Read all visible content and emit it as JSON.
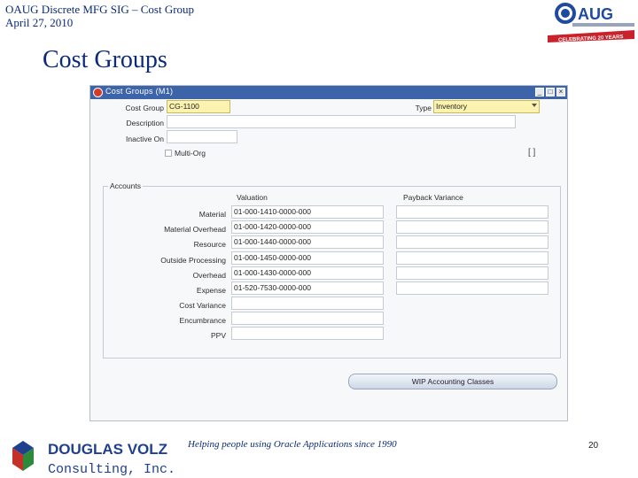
{
  "slide": {
    "header_line1": "OAUG Discrete MFG SIG – Cost Group",
    "header_line2": "April 27, 2010",
    "title": "Cost Groups",
    "footer_text": "Helping people using Oracle Applications since 1990",
    "page_number": "20",
    "oaug_logo_text": "OAUG",
    "oaug_banner": "CELEBRATING 20 YEARS",
    "company_line1": "DOUGLAS VOLZ",
    "company_line2": "Consulting, Inc.",
    "colors": {
      "title": "#0b2a7a",
      "titlebar": "#3d64a8",
      "required_field": "#fdf3b0"
    }
  },
  "window": {
    "title": "Cost Groups (M1)",
    "controls": [
      "_",
      "□",
      "×"
    ],
    "header_fields": {
      "cost_group_label": "Cost Group",
      "cost_group_value": "CG-1100",
      "type_label": "Type",
      "type_value": "Inventory",
      "description_label": "Description",
      "description_value": "",
      "inactive_on_label": "Inactive On",
      "inactive_on_value": "",
      "multi_org_label": "Multi-Org",
      "multi_org_checked": false,
      "side_hint": "[ ]"
    },
    "accounts": {
      "group_label": "Accounts",
      "valuation_header": "Valuation",
      "payback_header": "Payback Variance",
      "rows": [
        {
          "label": "Material",
          "valuation": "01-000-1410-0000-000",
          "payback": ""
        },
        {
          "label": "Material Overhead",
          "valuation": "01-000-1420-0000-000",
          "payback": ""
        },
        {
          "label": "Resource",
          "valuation": "01-000-1440-0000-000",
          "payback": ""
        },
        {
          "label": "Outside Processing",
          "valuation": "01-000-1450-0000-000",
          "payback": ""
        },
        {
          "label": "Overhead",
          "valuation": "01-000-1430-0000-000",
          "payback": ""
        },
        {
          "label": "Expense",
          "valuation": "01-520-7530-0000-000",
          "payback": ""
        },
        {
          "label": "Cost Variance",
          "valuation": ""
        },
        {
          "label": "Encumbrance",
          "valuation": ""
        },
        {
          "label": "PPV",
          "valuation": ""
        }
      ]
    },
    "wip_button": "WIP Accounting Classes"
  }
}
